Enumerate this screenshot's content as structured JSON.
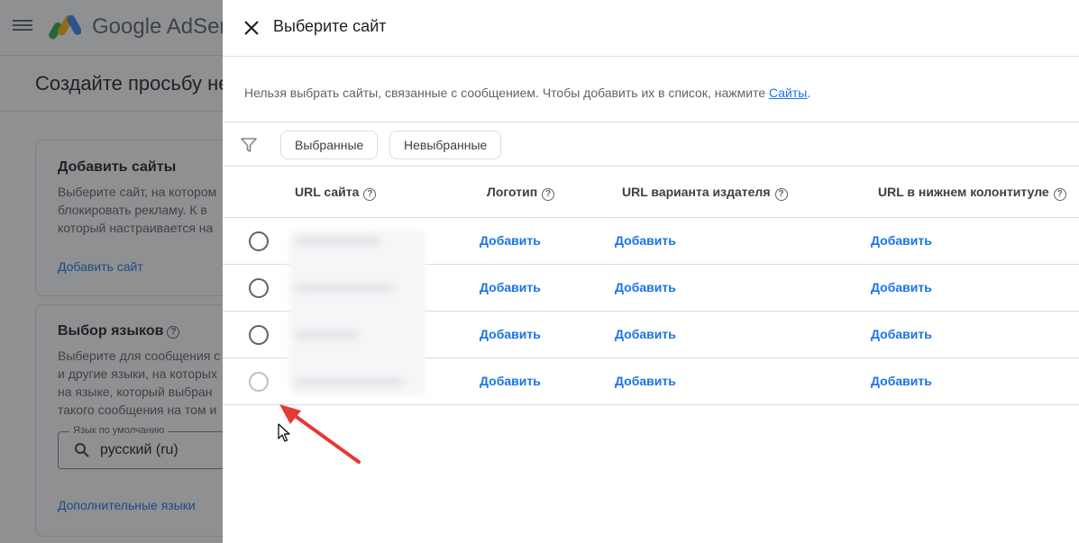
{
  "background": {
    "brand": "Google AdSense",
    "page_title": "Создайте просьбу не",
    "card_sites": {
      "title": "Добавить сайты",
      "lines": [
        "Выберите сайт, на котором",
        "блокировать рекламу. К в",
        "который настраивается на"
      ],
      "link": "Добавить сайт"
    },
    "card_languages": {
      "title": "Выбор языков",
      "lines": [
        "Выберите для сообщения с",
        "и другие языки, на которых",
        "на языке, который выбран",
        "такого сообщения на том и"
      ],
      "field_label": "Язык по умолчанию",
      "field_value": "русский (ru)",
      "link": "Дополнительные языки"
    }
  },
  "dialog": {
    "title": "Выберите сайт",
    "note_text": "Нельзя выбрать сайты, связанные с сообщением. Чтобы добавить их в список, нажмите ",
    "note_link": "Сайты",
    "note_end": ".",
    "filters": [
      "Выбранные",
      "Невыбранные"
    ],
    "columns": {
      "url": "URL сайта",
      "logo": "Логотип",
      "variant": "URL варианта издателя",
      "footer": "URL в нижнем колонтитуле"
    },
    "rows": [
      {
        "logo": "Добавить",
        "variant": "Добавить",
        "footer": "Добавить"
      },
      {
        "logo": "Добавить",
        "variant": "Добавить",
        "footer": "Добавить"
      },
      {
        "logo": "Добавить",
        "variant": "Добавить",
        "footer": "Добавить"
      },
      {
        "logo": "Добавить",
        "variant": "Добавить",
        "footer": "Добавить"
      }
    ]
  },
  "colors": {
    "accent": "#1a73e8",
    "annotation_arrow": "#e53935"
  }
}
